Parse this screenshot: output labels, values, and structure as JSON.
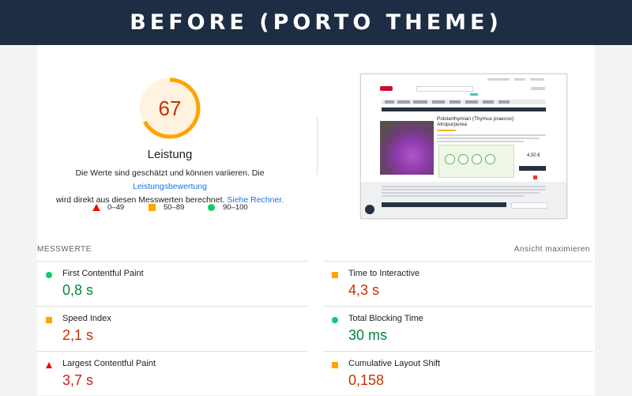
{
  "banner": {
    "title": "BEFORE (PORTO THEME)"
  },
  "gauge": {
    "score": "67",
    "score_fraction": 0.67,
    "title": "Leistung",
    "desc_part1": "Die Werte sind geschätzt und können variieren. Die ",
    "desc_link1": "Leistungsbewertung",
    "desc_part2": "wird direkt aus diesen Messwerten berechnet. ",
    "desc_link2": "Siehe Rechner."
  },
  "legend": [
    {
      "range": "0–49",
      "icon": "triangle-fail-icon"
    },
    {
      "range": "50–89",
      "icon": "square-average-icon"
    },
    {
      "range": "90–100",
      "icon": "circle-pass-icon"
    }
  ],
  "thumbnail": {
    "product_title": "Polsterthymian (Thymus praecox) Atropurpurea",
    "price": "4,50 €"
  },
  "metrics": {
    "heading": "MESSWERTE",
    "toggle": "Ansicht maximieren",
    "items": [
      {
        "name": "First Contentful Paint",
        "value": "0,8 s",
        "status": "pass"
      },
      {
        "name": "Time to Interactive",
        "value": "4,3 s",
        "status": "average"
      },
      {
        "name": "Speed Index",
        "value": "2,1 s",
        "status": "average"
      },
      {
        "name": "Total Blocking Time",
        "value": "30 ms",
        "status": "pass"
      },
      {
        "name": "Largest Contentful Paint",
        "value": "3,7 s",
        "status": "fail"
      },
      {
        "name": "Cumulative Layout Shift",
        "value": "0,158",
        "status": "average"
      }
    ]
  },
  "colors": {
    "banner_bg": "#1e2d44",
    "average": "#ffa400",
    "pass": "#0cce6b",
    "fail": "#eb0f00",
    "link": "#1a73e8"
  }
}
